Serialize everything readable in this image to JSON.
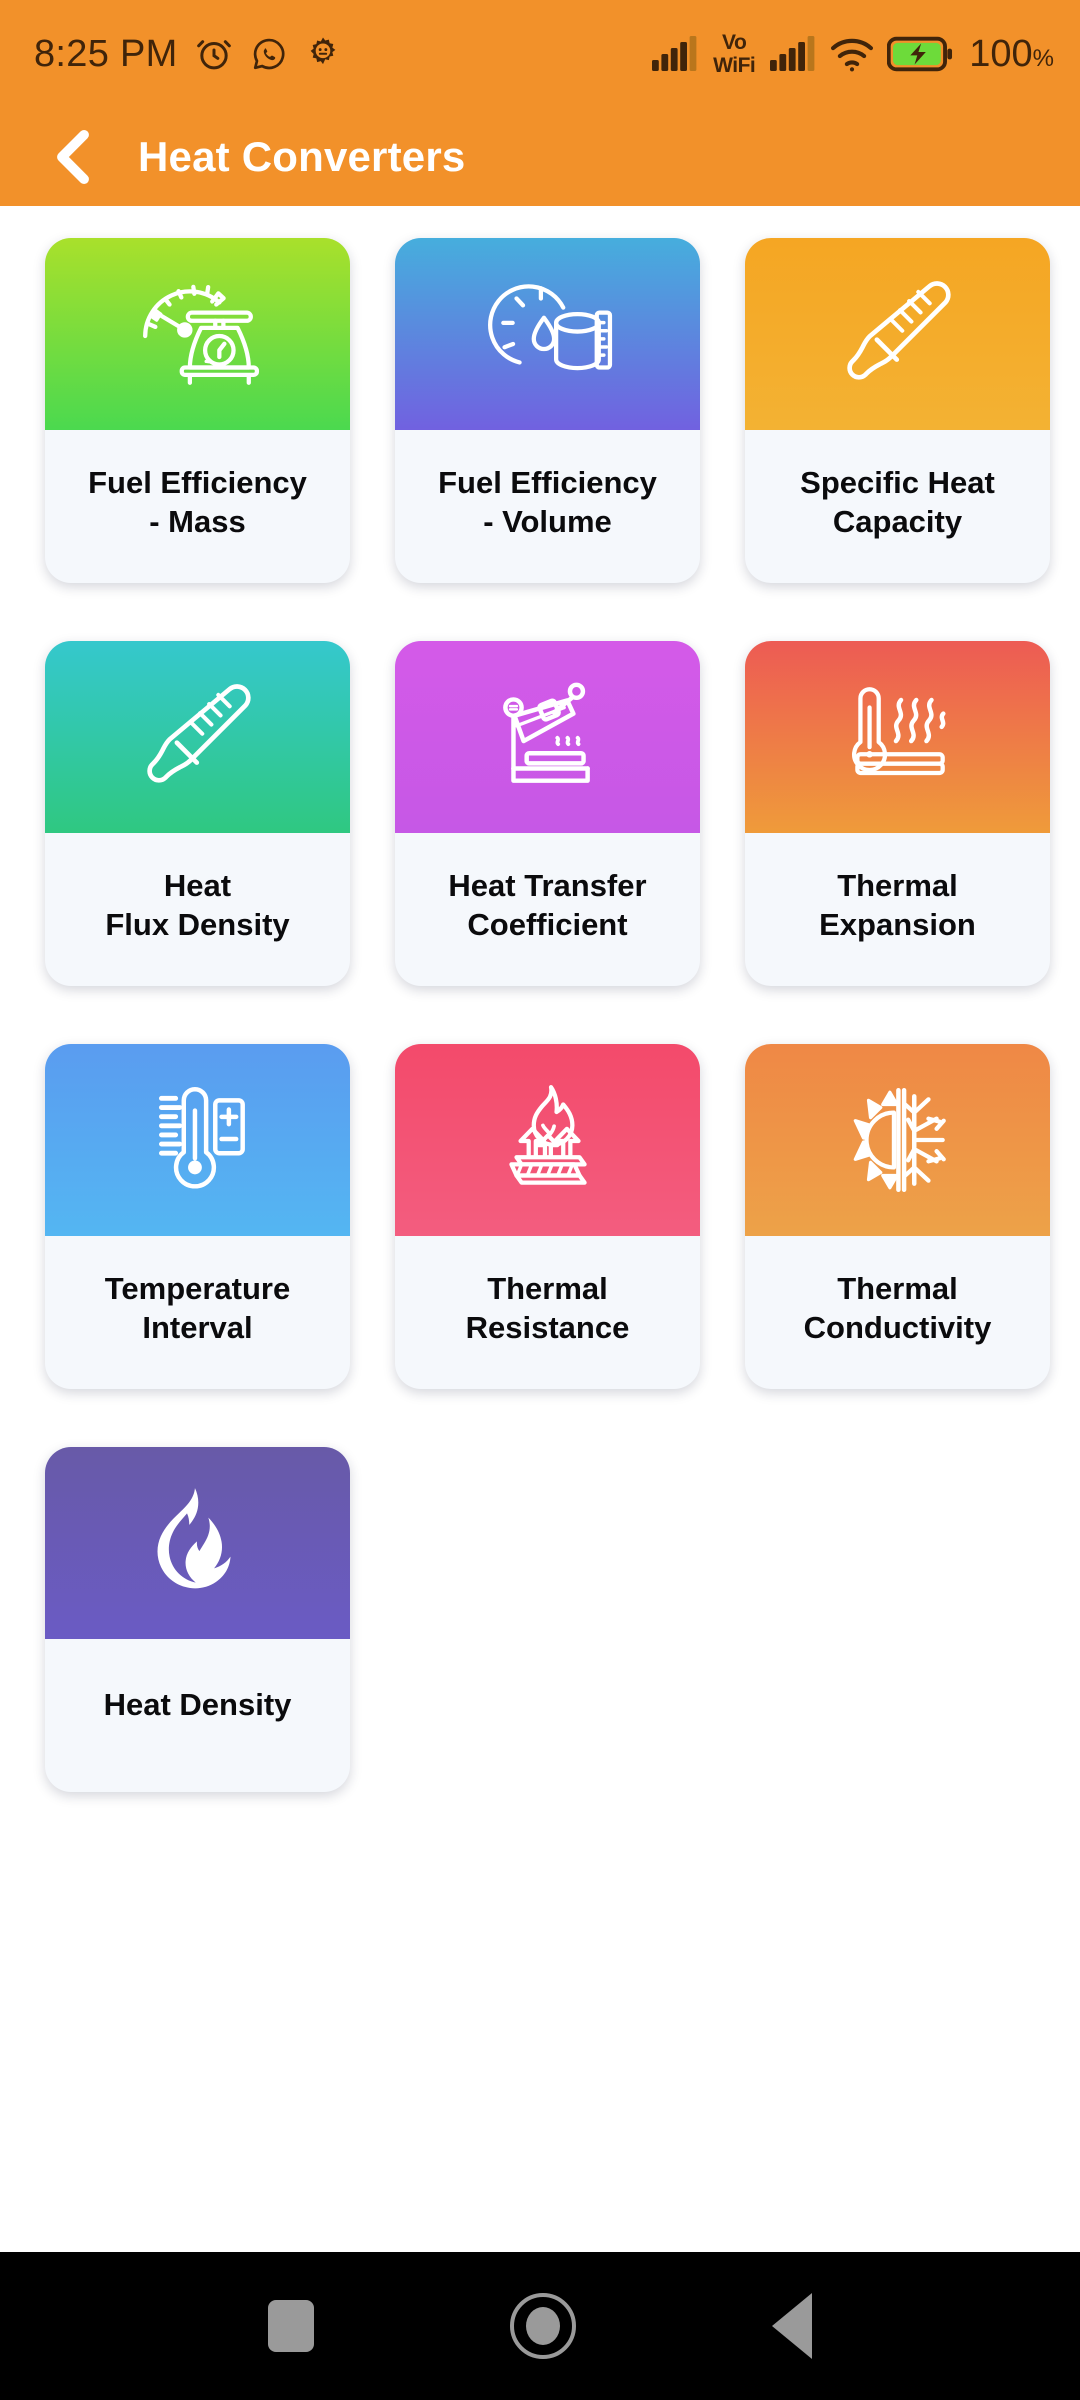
{
  "status_bar": {
    "time": "8:25 PM",
    "icons": [
      "alarm-icon",
      "whatsapp-icon",
      "gear-icon"
    ],
    "vowifi_line1": "Vo",
    "vowifi_line2": "WiFi",
    "battery_percent": "100",
    "percent_symbol": "%",
    "bg_color": "#f2912a",
    "battery_color": "#6ddb3a"
  },
  "app_bar": {
    "back_label": "back-chevron",
    "title": "Heat Converters",
    "bg_color": "#f2912a",
    "title_color": "#ffffff"
  },
  "grid": {
    "cards": [
      {
        "id": "fuel-efficiency-mass",
        "label": "Fuel Efficiency\n- Mass",
        "icon": "gauge-scale-icon",
        "gradient_from": "#a9e02b",
        "gradient_to": "#4bd94f"
      },
      {
        "id": "fuel-efficiency-volume",
        "label": "Fuel Efficiency\n- Volume",
        "icon": "gauge-droplet-cylinder-ruler-icon",
        "gradient_from": "#46aedd",
        "gradient_to": "#7161e0"
      },
      {
        "id": "specific-heat-capacity",
        "label": "Specific Heat\nCapacity",
        "icon": "thermometer-tilted-icon",
        "gradient_from": "#f5a623",
        "gradient_to": "#f3b233"
      },
      {
        "id": "heat-flux-density",
        "label": "Heat\nFlux Density",
        "icon": "thermometer-tilted-icon",
        "gradient_from": "#35c8cd",
        "gradient_to": "#2fc881"
      },
      {
        "id": "heat-transfer-coefficient",
        "label": "Heat Transfer\nCoefficient",
        "icon": "heat-press-icon",
        "gradient_from": "#d45ae8",
        "gradient_to": "#c658e6"
      },
      {
        "id": "thermal-expansion",
        "label": "Thermal\nExpansion",
        "icon": "thermometer-heatwaves-bar-icon",
        "gradient_from": "#ed5b54",
        "gradient_to": "#ef9b3a"
      },
      {
        "id": "temperature-interval",
        "label": "Temperature\nInterval",
        "icon": "thermometer-plusminus-icon",
        "gradient_from": "#5a9cf0",
        "gradient_to": "#54b6f2"
      },
      {
        "id": "thermal-resistance",
        "label": "Thermal\nResistance",
        "icon": "flame-barrier-arrows-icon",
        "gradient_from": "#f34a6b",
        "gradient_to": "#f35d7f"
      },
      {
        "id": "thermal-conductivity",
        "label": "Thermal\nConductivity",
        "icon": "sun-snowflake-icon",
        "gradient_from": "#ef8846",
        "gradient_to": "#eda248"
      },
      {
        "id": "heat-density",
        "label": "Heat Density",
        "icon": "flame-solid-icon",
        "gradient_from": "#685aa8",
        "gradient_to": "#6a5bc4"
      }
    ]
  },
  "nav_bar": {
    "recents_label": "recents-button",
    "home_label": "home-button",
    "back_label": "back-button",
    "bg_color": "#000000",
    "icon_color": "#9a9a9a"
  }
}
